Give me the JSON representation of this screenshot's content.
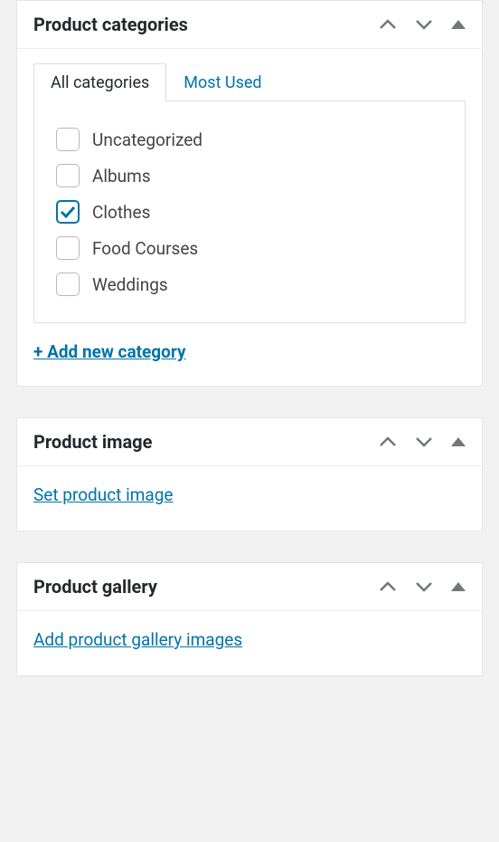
{
  "panels": {
    "categories": {
      "title": "Product categories",
      "tabs": {
        "active": "All categories",
        "inactive": "Most Used"
      },
      "items": [
        {
          "label": "Uncategorized",
          "checked": false
        },
        {
          "label": "Albums",
          "checked": false
        },
        {
          "label": "Clothes",
          "checked": true
        },
        {
          "label": "Food Courses",
          "checked": false
        },
        {
          "label": "Weddings",
          "checked": false
        }
      ],
      "add_link": "+ Add new category"
    },
    "image": {
      "title": "Product image",
      "link": "Set product image"
    },
    "gallery": {
      "title": "Product gallery",
      "link": "Add product gallery images"
    }
  }
}
